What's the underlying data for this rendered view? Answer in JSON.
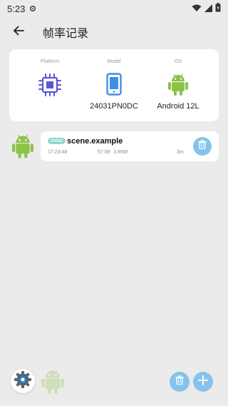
{
  "status_bar": {
    "time": "5:23"
  },
  "header": {
    "title": "帧率记录"
  },
  "device_info": {
    "platform_label": "Platform",
    "model_label": "Model",
    "os_label": "OS",
    "model_value": "24031PN0DC",
    "os_value": "Android 12L"
  },
  "record": {
    "badge": "today",
    "scene": "scene.example",
    "time": "17:23:48",
    "fps": "57.09",
    "power": "3.85W",
    "duration": "3m"
  },
  "colors": {
    "android_green": "#8bc34a",
    "accent_blue": "#86c3ec",
    "chip_purple": "#5a55d8",
    "phone_blue": "#3f8ee6"
  }
}
